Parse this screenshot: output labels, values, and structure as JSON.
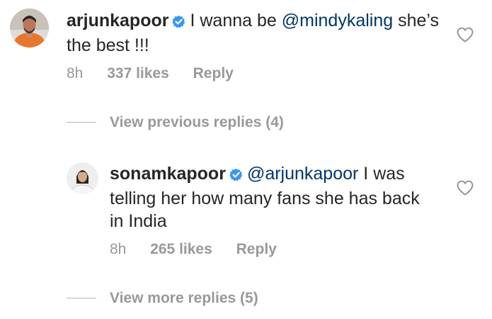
{
  "comments": [
    {
      "username": "arjunkapoor",
      "text_prefix": "I wanna be ",
      "mention": "@mindykaling",
      "text_suffix": " she’s the best !!!",
      "time": "8h",
      "likes": "337 likes",
      "reply_label": "Reply"
    },
    {
      "username": "sonamkapoor",
      "text_prefix": "",
      "mention": "@arjunkapoor",
      "text_suffix": " I was telling her how many fans she has back in India",
      "time": "8h",
      "likes": "265 likes",
      "reply_label": "Reply"
    }
  ],
  "view_previous_replies": "View previous replies (4)",
  "view_more_replies": "View more replies (5)",
  "colors": {
    "verified": "#3897f0",
    "mention": "#003569",
    "muted": "#999999",
    "text": "#262626"
  }
}
